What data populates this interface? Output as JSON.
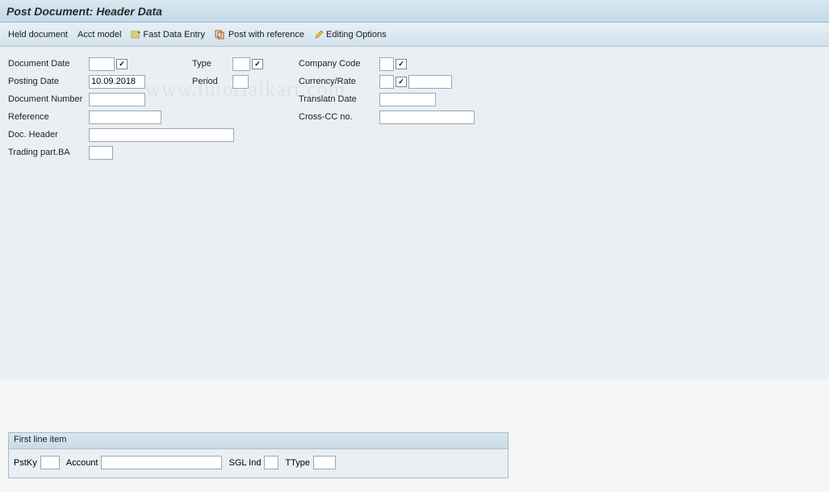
{
  "title": "Post Document: Header Data",
  "toolbar": {
    "held_document": "Held document",
    "acct_model": "Acct model",
    "fast_data_entry": "Fast Data Entry",
    "post_with_reference": "Post with reference",
    "editing_options": "Editing Options"
  },
  "fields": {
    "document_date": {
      "label": "Document Date",
      "value": ""
    },
    "posting_date": {
      "label": "Posting Date",
      "value": "10.09.2018"
    },
    "document_number": {
      "label": "Document Number",
      "value": ""
    },
    "reference": {
      "label": "Reference",
      "value": ""
    },
    "doc_header": {
      "label": "Doc. Header",
      "value": ""
    },
    "trading_part_ba": {
      "label": "Trading part.BA",
      "value": ""
    },
    "type": {
      "label": "Type",
      "value": ""
    },
    "period": {
      "label": "Period",
      "value": ""
    },
    "company_code": {
      "label": "Company Code",
      "value": ""
    },
    "currency_rate": {
      "label": "Currency/Rate",
      "value": "",
      "value2": ""
    },
    "translatn_date": {
      "label": "Translatn Date",
      "value": ""
    },
    "cross_cc_no": {
      "label": "Cross-CC no.",
      "value": ""
    }
  },
  "line_item_panel": {
    "title": "First line item",
    "pstky": {
      "label": "PstKy",
      "value": ""
    },
    "account": {
      "label": "Account",
      "value": ""
    },
    "sgl_ind": {
      "label": "SGL Ind",
      "value": ""
    },
    "ttype": {
      "label": "TType",
      "value": ""
    }
  },
  "watermark": "www.tutorialkart.com"
}
